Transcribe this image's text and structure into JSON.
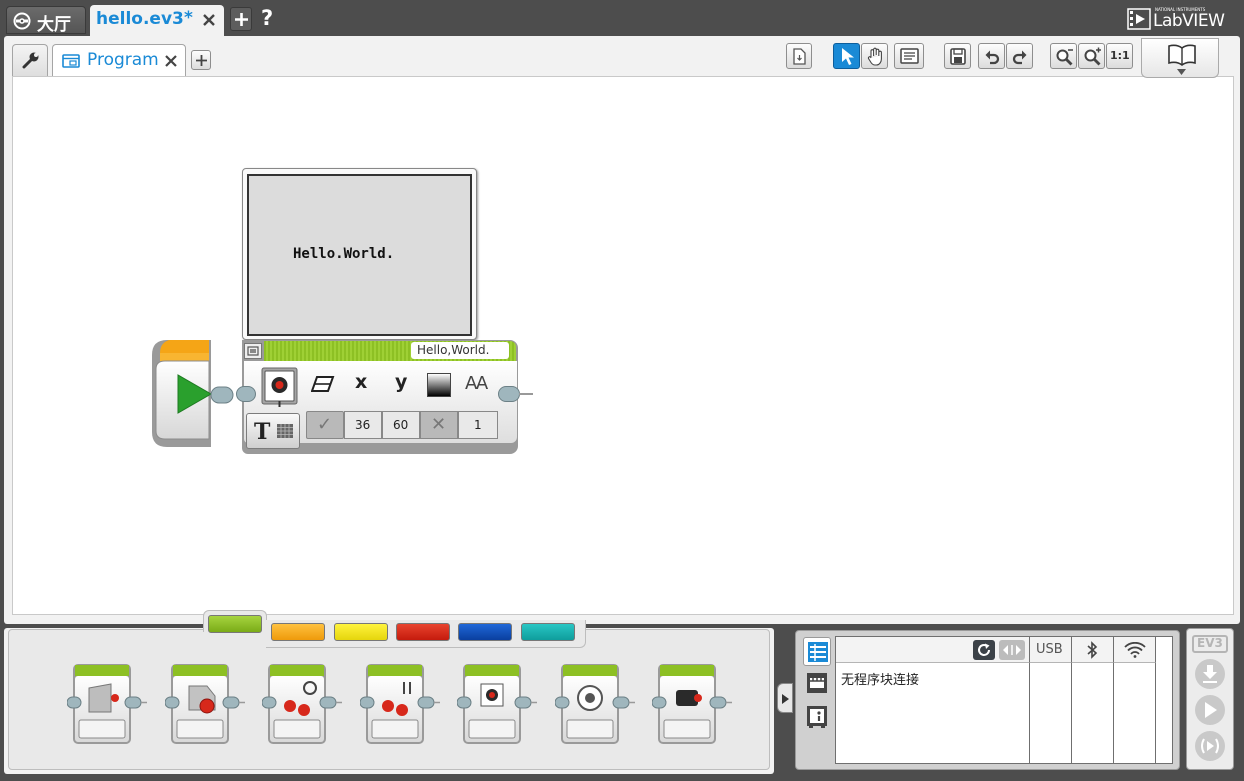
{
  "top_tabs": {
    "lobby_label": "大厅",
    "file_label": "hello.ev3",
    "file_modified": "*",
    "help_label": "?"
  },
  "brand": {
    "small_text": "NATIONAL INSTRUMENTS",
    "name": "LabVIEW"
  },
  "subtabs": {
    "program_label": "Program"
  },
  "toolbar": {
    "zoom_reset_label": "1:1"
  },
  "display_block": {
    "screen_text": "Hello.World.",
    "text_value": "Hello,World.",
    "params": {
      "clear": "✓",
      "x": "36",
      "y": "60",
      "color": "✕",
      "font": "1"
    },
    "labels": {
      "x": "x",
      "y": "y",
      "font": "AA"
    }
  },
  "palette": {
    "colors": [
      "#8dc024",
      "#f5a516",
      "#ece51a",
      "#d92917",
      "#0b4fbf",
      "#13b2b1"
    ]
  },
  "hardware": {
    "usb_label": "USB",
    "status_text": "无程序块连接"
  },
  "ev3_panel": {
    "label": "EV3"
  },
  "colors": {
    "accent": "#1a8ad6",
    "action_green": "#8dc024",
    "flow_orange": "#f5a516"
  }
}
